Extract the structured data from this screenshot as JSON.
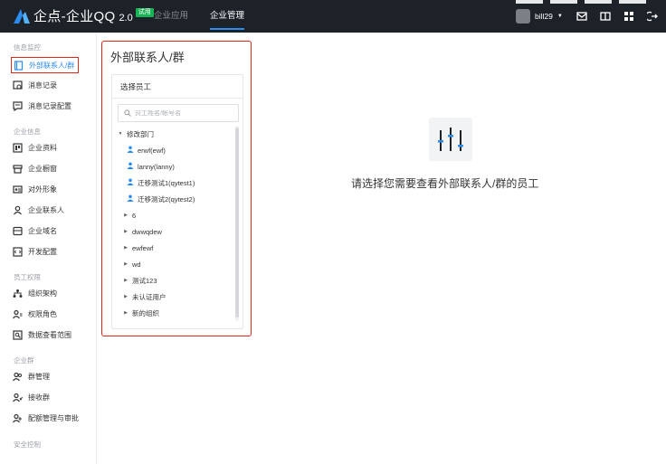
{
  "app": {
    "brand": "企点-企业QQ",
    "version": "2.0",
    "badge": "试用"
  },
  "nav": [
    {
      "label": "企业应用",
      "active": false
    },
    {
      "label": "企业管理",
      "active": true
    }
  ],
  "user": {
    "name": "bill29"
  },
  "sidebar": {
    "groups": [
      {
        "label": "信息监控"
      },
      {
        "label": "企业信息"
      },
      {
        "label": "员工权限"
      },
      {
        "label": "企业群"
      },
      {
        "label": "安全控制"
      }
    ],
    "items": [
      {
        "label": "外部联系人/群",
        "icon": "contacts-book-icon",
        "active": true
      },
      {
        "label": "消息记录",
        "icon": "message-record-icon"
      },
      {
        "label": "消息记录配置",
        "icon": "message-config-icon"
      },
      {
        "label": "企业资料",
        "icon": "company-profile-icon"
      },
      {
        "label": "企业橱窗",
        "icon": "showcase-icon"
      },
      {
        "label": "对外形象",
        "icon": "public-image-icon"
      },
      {
        "label": "企业联系人",
        "icon": "contact-person-icon"
      },
      {
        "label": "企业域名",
        "icon": "domain-icon"
      },
      {
        "label": "开发配置",
        "icon": "dev-config-icon"
      },
      {
        "label": "组织架构",
        "icon": "org-structure-icon"
      },
      {
        "label": "权限角色",
        "icon": "role-icon"
      },
      {
        "label": "数据查看范围",
        "icon": "data-scope-icon"
      },
      {
        "label": "群管理",
        "icon": "group-manage-icon"
      },
      {
        "label": "接收群",
        "icon": "receive-group-icon"
      },
      {
        "label": "配额管理与审批",
        "icon": "quota-icon"
      }
    ]
  },
  "panel": {
    "title": "外部联系人/群",
    "select_label": "选择员工",
    "search_placeholder": "员工姓名/帐号名",
    "tree": [
      {
        "label": "修改部门",
        "type": "dept",
        "expanded": true
      },
      {
        "label": "erwf(ewf)",
        "type": "person"
      },
      {
        "label": "lanny(lanny)",
        "type": "person"
      },
      {
        "label": "迁移测试1(qytest1)",
        "type": "person"
      },
      {
        "label": "迁移测试2(qytest2)",
        "type": "person"
      },
      {
        "label": "6",
        "type": "dept"
      },
      {
        "label": "dwwqdew",
        "type": "dept"
      },
      {
        "label": "ewfewf",
        "type": "dept"
      },
      {
        "label": "wd",
        "type": "dept"
      },
      {
        "label": "测试123",
        "type": "dept"
      },
      {
        "label": "未认证用户",
        "type": "dept"
      },
      {
        "label": "新的组织",
        "type": "dept"
      }
    ]
  },
  "empty_state": {
    "message": "请选择您需要查看外部联系人/群的员工",
    "icon": "sliders-icon"
  },
  "colors": {
    "topbar": "#1d2128",
    "accent": "#2d8cf0",
    "highlight": "#e0281f",
    "badge": "#16b455"
  }
}
